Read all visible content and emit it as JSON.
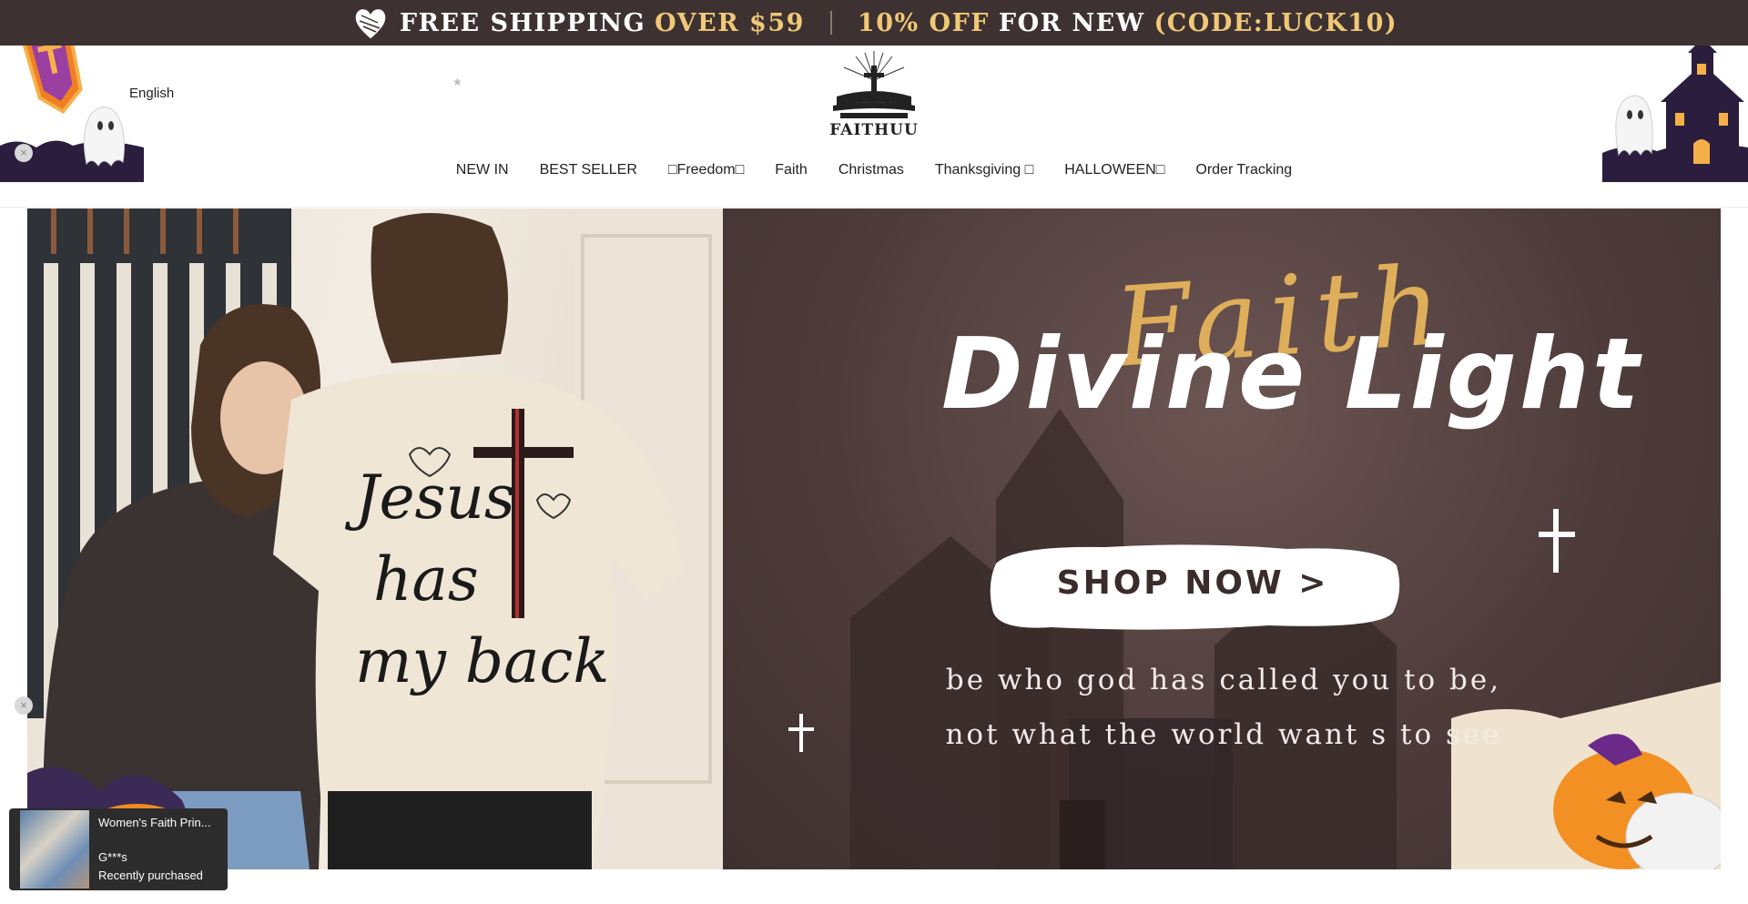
{
  "announcement": {
    "part1": "FREE SHIPPING",
    "part2": "OVER $59",
    "part3": "10% OFF",
    "part4": "FOR NEW",
    "part5": "(CODE:LUCK10)"
  },
  "header": {
    "language": "English",
    "brand": "FAITHUU"
  },
  "nav": {
    "items": [
      "NEW IN",
      "BEST SELLER",
      "□Freedom□",
      "Faith",
      "Christmas",
      "Thanksgiving □",
      "HALLOWEEN□",
      "Order Tracking"
    ]
  },
  "hero": {
    "script_word": "Faith",
    "headline": "Divine Light",
    "cta": "SHOP NOW >",
    "tagline_line1": "be who god has called you to be,",
    "tagline_line2": "not what the world want s to see",
    "shirt_text": [
      "Jesus",
      "has",
      "my back"
    ]
  },
  "toast": {
    "product": "Women's Faith Prin...",
    "buyer": "G***s",
    "status": "Recently purchased"
  },
  "icons": {
    "close": "close-icon",
    "star": "star-icon",
    "heart": "heart-icon"
  },
  "colors": {
    "announce_bg": "#3d3231",
    "gold": "#f0c877",
    "hero_bg": "#4e3c3b",
    "script": "#e6b45c"
  }
}
